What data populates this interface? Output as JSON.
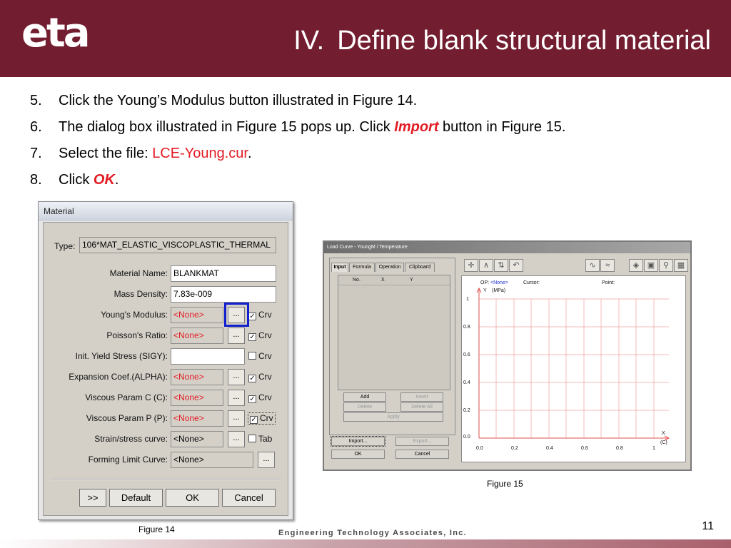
{
  "header": {
    "logo": "eta",
    "title_num": "IV.",
    "title_text": "Define blank structural material",
    "bg_color": "#731e30"
  },
  "steps": [
    {
      "num": "5.",
      "text": "Click the Young’s Modulus button illustrated in Figure 14."
    },
    {
      "num": "6.",
      "pre": "The dialog box illustrated in Figure 15 pops up. Click ",
      "em": "Import",
      "post": " button in Figure 15."
    },
    {
      "num": "7.",
      "pre": "Select the file: ",
      "red": "LCE-Young.cur",
      "post": "."
    },
    {
      "num": "8.",
      "pre": "Click ",
      "em": "OK",
      "post": "."
    }
  ],
  "material_dialog": {
    "title": "Material",
    "type_label": "Type:",
    "type_value": "106*MAT_ELASTIC_VISCOPLASTIC_THERMAL",
    "fields": [
      {
        "label": "Material Name:",
        "value": "BLANKMAT"
      },
      {
        "label": "Mass Density:",
        "value": "7.83e-009"
      }
    ],
    "rows": [
      {
        "label": "Young's Modulus:",
        "value": "<None>",
        "dots": "...",
        "check": "Crv",
        "checked": true
      },
      {
        "label": "Poisson's Ratio:",
        "value": "<None>",
        "dots": "...",
        "check": "Crv",
        "checked": true
      },
      {
        "label": "Init. Yield Stress (SIGY):",
        "value": "",
        "check": "Crv",
        "checked": false
      },
      {
        "label": "Expansion Coef.(ALPHA):",
        "value": "<None>",
        "dots": "...",
        "check": "Crv",
        "checked": true
      },
      {
        "label": "Viscous Param C (C):",
        "value": "<None>",
        "dots": "...",
        "check": "Crv",
        "checked": true
      },
      {
        "label": "Viscous Param P (P):",
        "value": "<None>",
        "dots": "...",
        "check": "Crv",
        "checked": true
      },
      {
        "label": "Strain/stress curve:",
        "value": "<None>",
        "dots": "...",
        "check": "Tab",
        "checked": false
      },
      {
        "label": "Forming Limit Curve:",
        "value": "<None>",
        "dots": "..."
      }
    ],
    "buttons": [
      ">>",
      "Default",
      "OK",
      "Cancel"
    ],
    "caption": "Figure 14"
  },
  "load_curve_dialog": {
    "title": "Load Curve - YoungM / Temperature",
    "tabs": [
      "Input",
      "Formula",
      "Operation",
      "Clipboard"
    ],
    "columns": [
      "No.",
      "X",
      "Y"
    ],
    "buttons": {
      "add": "Add",
      "insert": "Insert",
      "delete": "Delete",
      "delete_all": "Delete All",
      "apply": "Apply",
      "import": "Import...",
      "export": "Export...",
      "ok": "OK",
      "cancel": "Cancel"
    },
    "plot": {
      "op_label": "OP:",
      "op_value": "<None>",
      "cursor_label": "Cursor:",
      "point_label": "Point:",
      "y_label": "Y",
      "y_unit": "(MPa)",
      "x_label": "X",
      "x_unit": "(C)",
      "y_ticks": [
        "1",
        "0.8",
        "0.6",
        "0.4",
        "0.2",
        "0.0"
      ],
      "x_ticks": [
        "0.0",
        "0.2",
        "0.4",
        "0.6",
        "0.8",
        "1"
      ]
    },
    "caption": "Figure 15"
  },
  "footer": {
    "company": "Engineering Technology Associates, Inc.",
    "page": "11"
  }
}
